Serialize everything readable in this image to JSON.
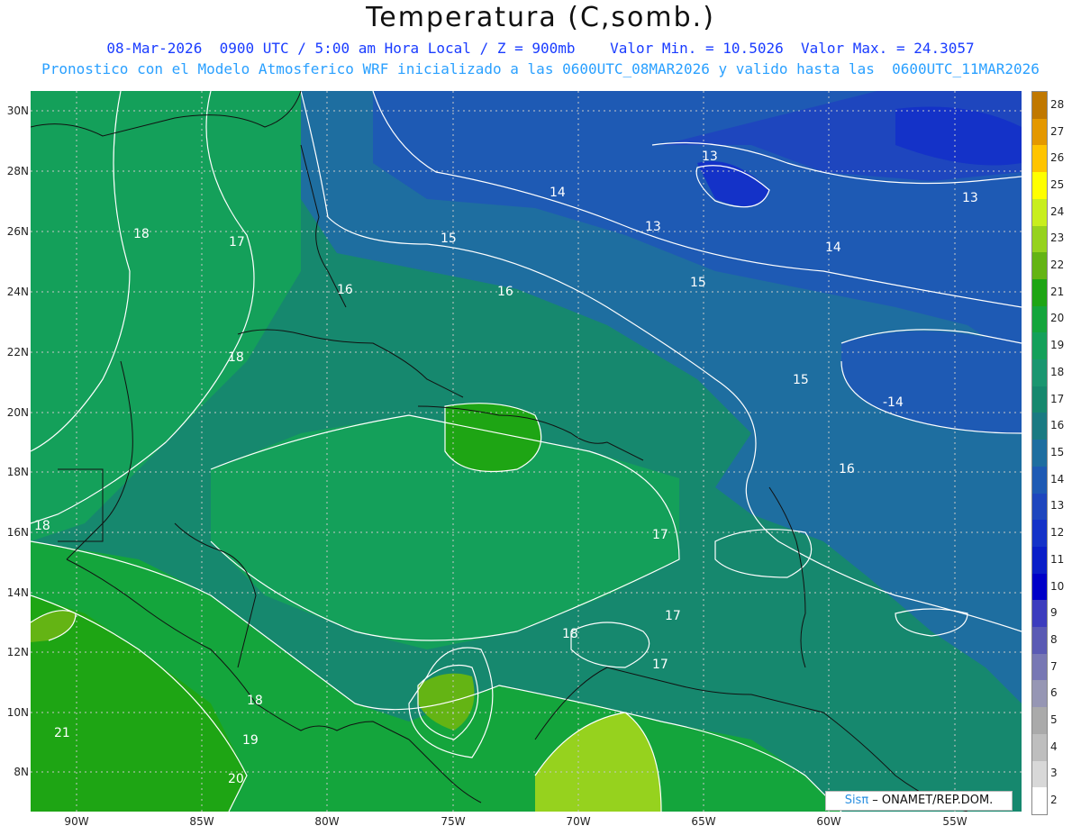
{
  "header": {
    "title": "Temperatura (C,somb.)",
    "subtitle1": "08-Mar-2026  0900 UTC / 5:00 am Hora Local / Z = 900mb    Valor Min. = 10.5026  Valor Max. = 24.3057",
    "subtitle2": "Pronostico con el Modelo Atmosferico WRF inicializado a las 0600UTC_08MAR2026 y valido hasta las  0600UTC_11MAR2026"
  },
  "axes": {
    "lat_labels": [
      "30N",
      "28N",
      "26N",
      "24N",
      "22N",
      "20N",
      "18N",
      "16N",
      "14N",
      "12N",
      "10N",
      "8N"
    ],
    "lon_labels": [
      "90W",
      "85W",
      "80W",
      "75W",
      "70W",
      "65W",
      "60W",
      "55W"
    ]
  },
  "colorbar": {
    "levels": [
      "28",
      "27",
      "26",
      "25",
      "24",
      "23",
      "22",
      "21",
      "20",
      "19",
      "18",
      "17",
      "16",
      "15",
      "14",
      "13",
      "12",
      "11",
      "10",
      "9",
      "8",
      "7",
      "6",
      "5",
      "4",
      "3",
      "2"
    ],
    "colors": [
      "#c07800",
      "#e49800",
      "#ffc400",
      "#ffff00",
      "#c8ee1e",
      "#96d21e",
      "#64b414",
      "#1ea514",
      "#14a53c",
      "#14a05a",
      "#1a9670",
      "#16886e",
      "#1a7a82",
      "#1e6ea0",
      "#1e5ab4",
      "#1e46be",
      "#1432c8",
      "#0a1ec8",
      "#0000c8",
      "#3c3cbe",
      "#5a5ab4",
      "#7878b4",
      "#9696b4",
      "#aaaaaa",
      "#bebebe",
      "#d8d8d8",
      "#ffffff"
    ]
  },
  "contour_labels": [
    "18",
    "17",
    "16",
    "16",
    "15",
    "14",
    "13",
    "13",
    "14",
    "13",
    "15",
    "18",
    "18",
    "15",
    "-14",
    "16",
    "17",
    "17",
    "17",
    "18",
    "18",
    "21",
    "19",
    "20"
  ],
  "credit": {
    "brand": "Sisπ",
    "text": " – ONAMET/REP.DOM."
  }
}
